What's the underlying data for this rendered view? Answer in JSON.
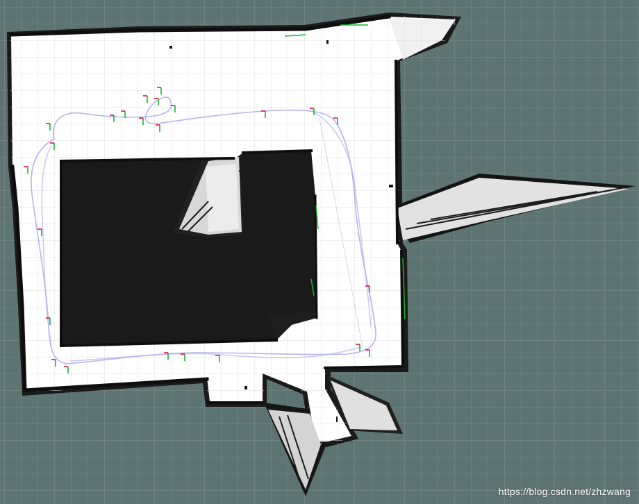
{
  "viewport": {
    "background_color": "#5e7472",
    "grid_color": "#7a8c8a",
    "free_space_color": "#ffffff",
    "obstacle_color": "#111111",
    "trajectory_color": "#b7b3ee",
    "frame_x_color": "#e0103a",
    "frame_y_color": "#13b82a"
  },
  "watermark": {
    "text": "https://blog.csdn.net/zhzwang"
  }
}
